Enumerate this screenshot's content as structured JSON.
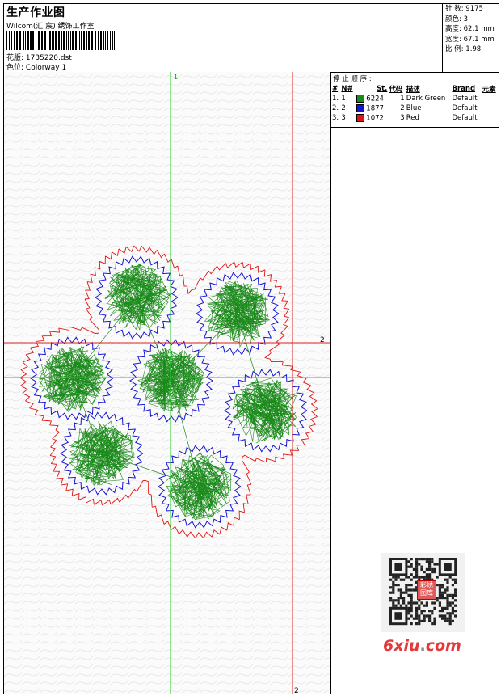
{
  "header": {
    "title": "生产作业图",
    "studio": "Wilcom(汇 宸) 绣饰工作室",
    "design_label": "花版:",
    "design_file": "1735220.dst",
    "colorway_label": "色位:",
    "colorway": "Colorway 1"
  },
  "stats": [
    {
      "label": "针 数:",
      "value": "9175"
    },
    {
      "label": "颜色:",
      "value": "3"
    },
    {
      "label": "高度:",
      "value": "62.1 mm"
    },
    {
      "label": "宽度:",
      "value": "67.1 mm"
    },
    {
      "label": "比 例:",
      "value": "1.98"
    }
  ],
  "stop_sequence": {
    "title": "停 止 顺 序 :",
    "columns": [
      "#",
      "N#",
      "St.",
      "代码",
      "描述",
      "Brand",
      "元素"
    ],
    "rows": [
      {
        "num": "1.",
        "n": "1",
        "stitches": "6224",
        "code": "1",
        "desc": "Dark Green",
        "brand": "Default",
        "color": "#1a8a1a"
      },
      {
        "num": "2.",
        "n": "2",
        "stitches": "1877",
        "code": "2",
        "desc": "Blue",
        "brand": "Default",
        "color": "#1414d4"
      },
      {
        "num": "3.",
        "n": "3",
        "stitches": "1072",
        "code": "3",
        "desc": "Red",
        "brand": "Default",
        "color": "#e01414"
      }
    ]
  },
  "guides": {
    "green_label": "1",
    "red_h_label": "2",
    "red_v_label": "2"
  },
  "watermark": {
    "brand_main": "6xiu",
    "brand_dot": ".",
    "brand_tld": "com",
    "stamp": "彩绣 图库"
  },
  "colors": {
    "green": "#1a8a1a",
    "blue": "#1414d4",
    "red": "#e01414",
    "guide_green": "#22cc22",
    "guide_red": "#dd2222"
  }
}
